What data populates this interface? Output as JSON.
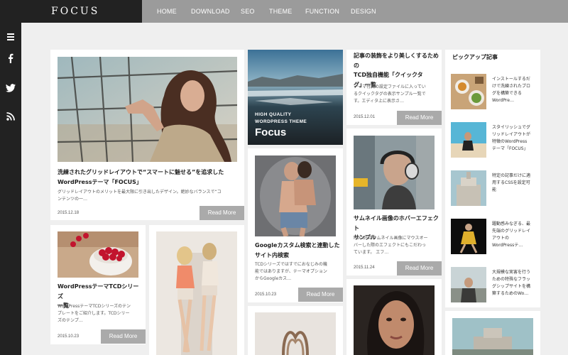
{
  "logo": "FOCUS",
  "nav": [
    "HOME",
    "DOWNLOAD",
    "SEO",
    "THEME",
    "FUNCTION",
    "DESIGN"
  ],
  "sidebar": {
    "icons": [
      "menu-icon",
      "facebook-icon",
      "twitter-icon",
      "rss-icon"
    ]
  },
  "read_more": "Read More",
  "posts": {
    "p1": {
      "title": [
        "洗練されたグリッドレイアウトで“スマートに魅せる”を追求した",
        "WordPressテーマ「FOCUS」"
      ],
      "excerpt": [
        "グリッドレイアウトのメリットを最大限に引き出したデザイン。絶妙なバランスで“コ",
        "ンテンツの一…"
      ],
      "date": "2015.12.18"
    },
    "p2": {
      "title": [
        "WordPressテーマTCDシリーズ",
        "一覧"
      ],
      "excerpt": [
        "WordPressテーマTCDシリーズのテン",
        "プレートをご紹介します。TCDシリー",
        "ズのテンプ…"
      ],
      "date": "2015.10.23"
    },
    "hero": {
      "line1": "HIGH QUALITY",
      "line2": "WORDPRESS THEME",
      "line3": "Focus"
    },
    "p4": {
      "title": [
        "Googleカスタム検索と連動した",
        "サイト内検索"
      ],
      "excerpt": [
        "TCDシリーズではすでにおなじみの機",
        "能ではありますが、テーマオプション",
        "からGoogleカス…"
      ],
      "date": "2015.10.23"
    },
    "p5": {
      "title": [
        "記事の装飾をより美しくするための",
        "TCD独自機能「クイックタ",
        "グ」一覧"
      ],
      "excerpt": [
        "テーマ付属の設定ファイルに入ってい",
        "るクイックタグの表示サンプル一覧で",
        "す。エディタ上に表示さ…"
      ],
      "date": "2015.12.01"
    },
    "p6": {
      "title": [
        "サムネイル画像のホバーエフェクト",
        "サンプル"
      ],
      "excerpt": [
        "FOCUSはサムネイル画像にマウスオー",
        "バーした際のエフェクトにもこだわっ",
        "ています。 エフ…"
      ],
      "date": "2015.11.24"
    }
  },
  "pickup": {
    "title": "ピックアップ記事",
    "items": [
      [
        "インストールするだ",
        "けで洗練されたブロ",
        "グを構築できる",
        "WordPre…"
      ],
      [
        "スタイリッシュでグ",
        "リッドレイアウトが",
        "特徴のWordPress",
        "テーマ「FOCUS」"
      ],
      [
        "特定の記事だけに適",
        "用するCSSを設定可",
        "能"
      ],
      [
        "躍動感みなぎる、最",
        "先端のグリッドレイ",
        "アウトの",
        "WordPressテ…"
      ],
      [
        "大規模な実害を行う",
        "ための特殊なフラッ",
        "グシップサイトを構",
        "築するためのWo…"
      ]
    ]
  },
  "colors": {
    "dark": "#222222",
    "nav": "#9b9b9b",
    "button": "#aaaaaa",
    "bg": "#efefef"
  }
}
